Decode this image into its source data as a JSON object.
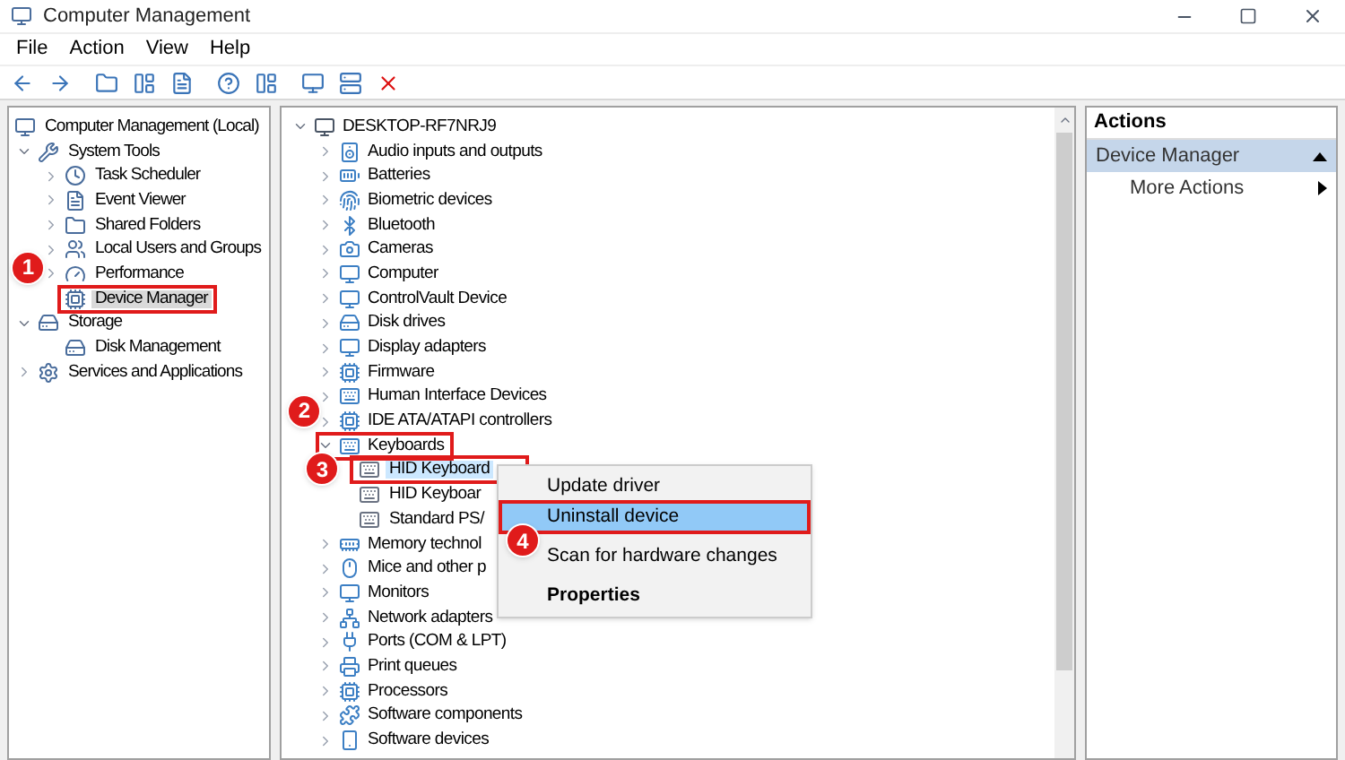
{
  "window": {
    "title": "Computer Management"
  },
  "menu": [
    "File",
    "Action",
    "View",
    "Help"
  ],
  "nav_tree": [
    {
      "label": "Computer Management (Local)",
      "selected": false,
      "children": [
        {
          "label": "System Tools",
          "expanded": true,
          "selected": false,
          "children": [
            {
              "label": "Task Scheduler",
              "expanded": false,
              "selected": false
            },
            {
              "label": "Event Viewer",
              "expanded": false,
              "selected": false
            },
            {
              "label": "Shared Folders",
              "expanded": false,
              "selected": false
            },
            {
              "label": "Local Users and Groups",
              "expanded": false,
              "selected": false
            },
            {
              "label": "Performance",
              "expanded": false,
              "selected": false
            },
            {
              "label": "Device Manager",
              "selected": true,
              "callout": "1"
            }
          ]
        },
        {
          "label": "Storage",
          "expanded": true,
          "selected": false,
          "children": [
            {
              "label": "Disk Management",
              "selected": false
            }
          ]
        },
        {
          "label": "Services and Applications",
          "expanded": false,
          "selected": false
        }
      ]
    }
  ],
  "device_tree": {
    "label": "DESKTOP-RF7NRJ9",
    "expanded": true,
    "children": [
      {
        "label": "Audio inputs and outputs",
        "expanded": false,
        "selected": false
      },
      {
        "label": "Batteries",
        "expanded": false,
        "selected": false
      },
      {
        "label": "Biometric devices",
        "expanded": false,
        "selected": false
      },
      {
        "label": "Bluetooth",
        "expanded": false,
        "selected": false
      },
      {
        "label": "Cameras",
        "expanded": false,
        "selected": false
      },
      {
        "label": "Computer",
        "expanded": false,
        "selected": false
      },
      {
        "label": "ControlVault Device",
        "expanded": false,
        "selected": false
      },
      {
        "label": "Disk drives",
        "expanded": false,
        "selected": false
      },
      {
        "label": "Display adapters",
        "expanded": false,
        "selected": false
      },
      {
        "label": "Firmware",
        "expanded": false,
        "selected": false
      },
      {
        "label": "Human Interface Devices",
        "expanded": false,
        "selected": false
      },
      {
        "label": "IDE ATA/ATAPI controllers",
        "expanded": false,
        "selected": false
      },
      {
        "label": "Keyboards",
        "expanded": true,
        "selected": false,
        "callout": "2",
        "children": [
          {
            "label": "HID Keyboard",
            "selected": true,
            "callout": "3"
          },
          {
            "label": "HID Keyboar",
            "selected": false
          },
          {
            "label": "Standard PS/",
            "selected": false
          }
        ]
      },
      {
        "label": "Memory technol",
        "expanded": false,
        "selected": false
      },
      {
        "label": "Mice and other p",
        "expanded": false,
        "selected": false
      },
      {
        "label": "Monitors",
        "expanded": false,
        "selected": false
      },
      {
        "label": "Network adapters",
        "expanded": false,
        "selected": false
      },
      {
        "label": "Ports (COM & LPT)",
        "expanded": false,
        "selected": false
      },
      {
        "label": "Print queues",
        "expanded": false,
        "selected": false
      },
      {
        "label": "Processors",
        "expanded": false,
        "selected": false
      },
      {
        "label": "Software components",
        "expanded": false,
        "selected": false
      },
      {
        "label": "Software devices",
        "expanded": false,
        "selected": false
      }
    ]
  },
  "context_menu": [
    {
      "label": "Update driver",
      "kind": "item",
      "selected": false
    },
    {
      "label": "Uninstall device",
      "kind": "item",
      "selected": true,
      "callout": "4"
    },
    {
      "label": "Scan for hardware changes",
      "kind": "item",
      "selected": false
    },
    {
      "label": "Properties",
      "kind": "default",
      "selected": false
    }
  ],
  "actions": {
    "title": "Actions",
    "section": "Device Manager",
    "items": [
      "More Actions"
    ]
  }
}
